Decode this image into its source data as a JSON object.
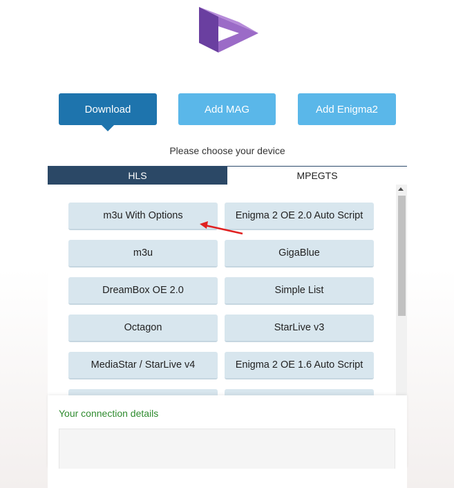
{
  "logo": {
    "icon": "play-logo-icon",
    "colors": [
      "#6a3fa0",
      "#9b6bc7",
      "#b68bd9"
    ]
  },
  "top_buttons": {
    "download": "Download",
    "add_mag": "Add MAG",
    "add_enigma2": "Add Enigma2"
  },
  "panel": {
    "prompt": "Please choose your device",
    "tabs": [
      {
        "label": "HLS",
        "active": true
      },
      {
        "label": "MPEGTS",
        "active": false
      }
    ],
    "devices": [
      "m3u With Options",
      "Enigma 2 OE 2.0 Auto Script",
      "m3u",
      "GigaBlue",
      "DreamBox OE 2.0",
      "Simple List",
      "Octagon",
      "StarLive v3",
      "MediaStar / StarLive v4",
      "Enigma 2 OE 1.6 Auto Script",
      "",
      ""
    ]
  },
  "details": {
    "title": "Your connection details",
    "value": ""
  },
  "colors": {
    "primary": "#1e74ad",
    "secondary": "#5ab7e9",
    "tab_active": "#2b4866",
    "device_button": "#d8e6ee",
    "details_title": "#2e8b2e",
    "annotation_arrow": "#e02020"
  }
}
